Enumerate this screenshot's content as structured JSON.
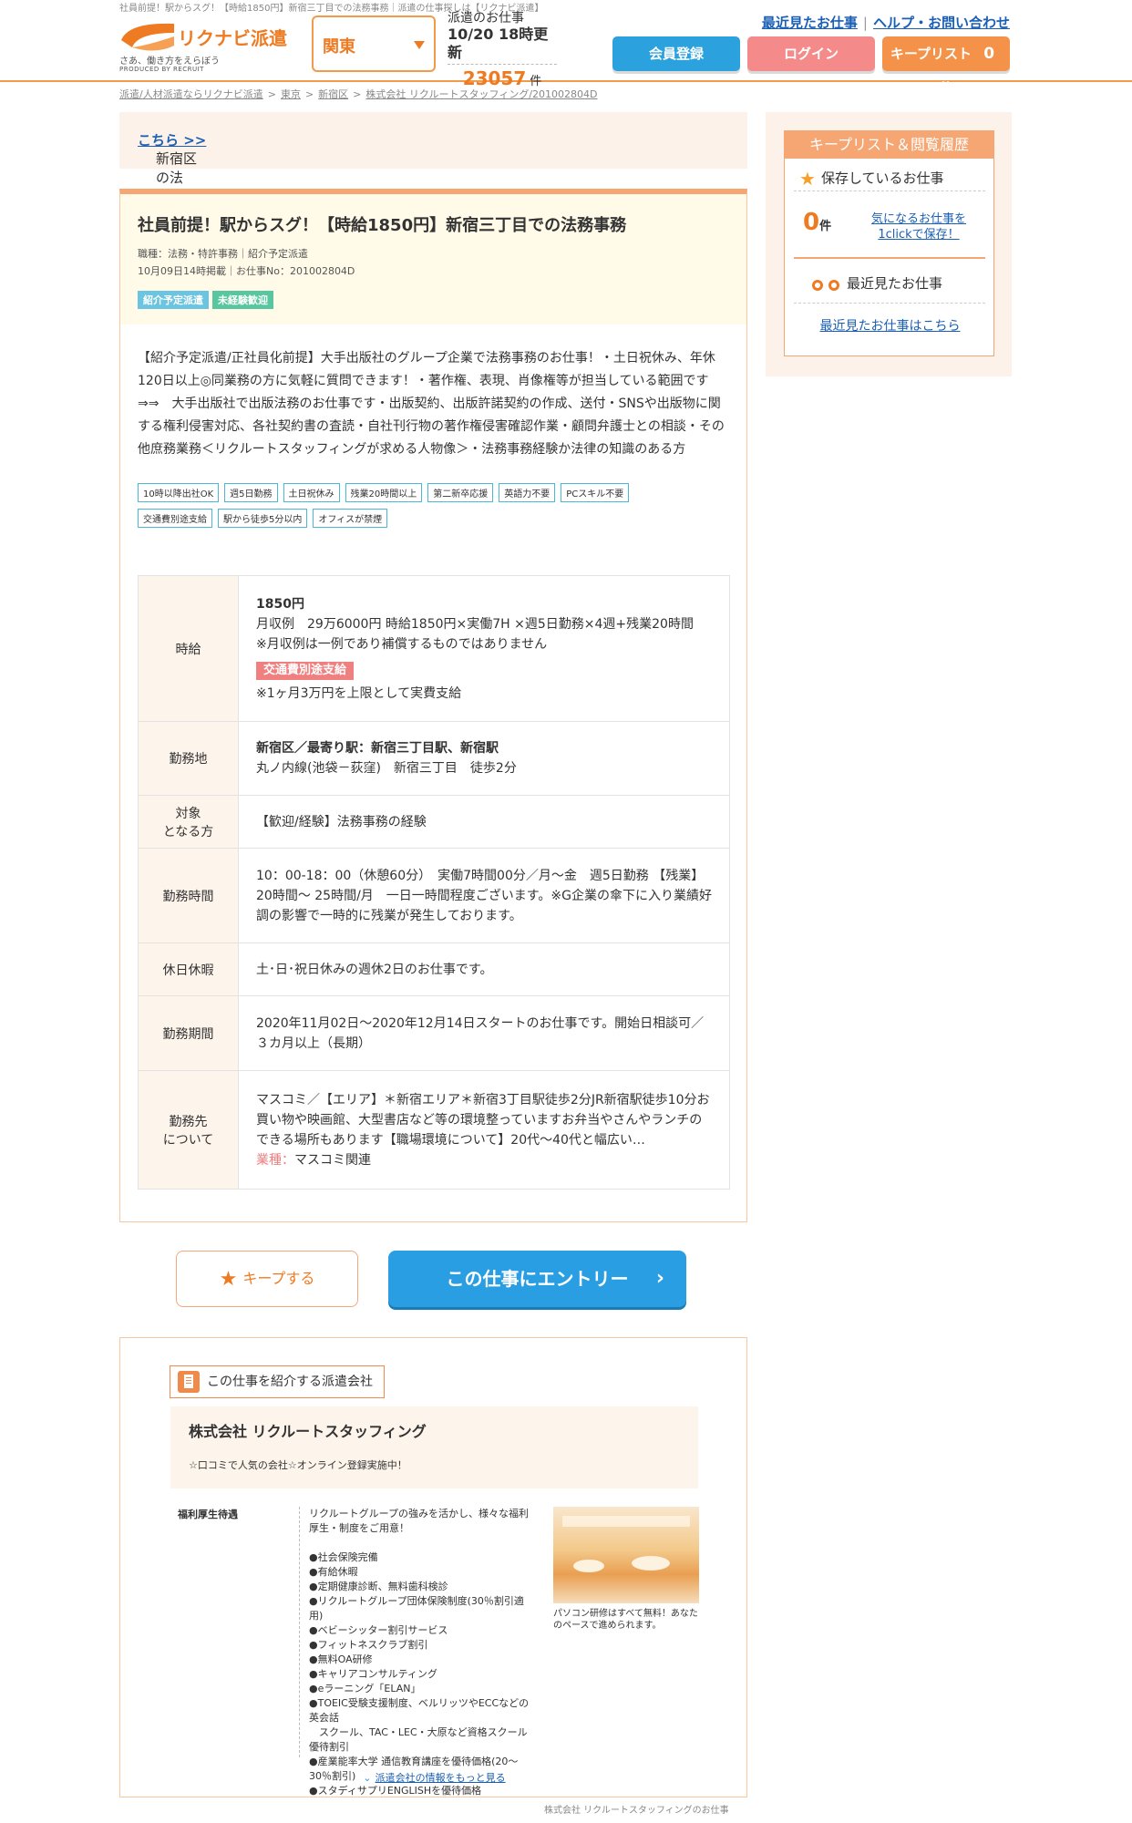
{
  "page": {
    "top_line": "社員前提！駅からスグ！【時給1850円】新宿三丁目での法務事務｜派遣の仕事探しは【リクナビ派遣】"
  },
  "header": {
    "logo_text": "リクナビ派遣",
    "logo_tagline": "さあ、働き方をえらぼう",
    "logo_produced": "PRODUCED BY RECRUIT",
    "region": "関東",
    "count_label": "派遣のお仕事",
    "count_updated": "10/20 18時更新",
    "count_number": "23057",
    "count_unit": "件",
    "links": [
      "最近見たお仕事",
      "ヘルプ・お問い合わせ"
    ],
    "register_label": "会員登録",
    "login_label": "ログイン",
    "keeplist_label": "キープリスト",
    "keeplist_count": "0",
    "keeplist_unit": "件"
  },
  "breadcrumb": [
    "派遣/人材派遣ならリクナビ派遣",
    "東京",
    "新宿区",
    "株式会社 リクルートスタッフィング/201002804D"
  ],
  "notice": {
    "text": "新宿区の法務・特許事務のお仕事一覧は",
    "link": "こちら >>"
  },
  "job": {
    "title": "社員前提！駅からスグ！【時給1850円】新宿三丁目での法務事務",
    "category": "職種：法務・特許事務｜紹介予定派遣",
    "posted": "10月09日14時掲載｜お仕事No：201002804D",
    "badges": [
      "紹介予定派遣",
      "未経験歓迎"
    ],
    "description": "【紹介予定派遣/正社員化前提】大手出版社のグループ企業で法務事務のお仕事！・土日祝休み、年休120日以上◎同業務の方に気軽に質問できます！・著作権、表現、肖像権等が担当している範囲です　⇒⇒　大手出版社で出版法務のお仕事です・出版契約、出版許諾契約の作成、送付・SNSや出版物に関する権利侵害対応、各社契約書の査読・自社刊行物の著作権侵害確認作業・顧問弁護士との相談・その他庶務業務＜リクルートスタッフィングが求める人物像＞・法務事務経験か法律の知識のある方",
    "tags": [
      "10時以降出社OK",
      "週5日勤務",
      "土日祝休み",
      "残業20時間以上",
      "第二新卒応援",
      "英語力不要",
      "PCスキル不要",
      "交通費別途支給",
      "駅から徒歩5分以内",
      "オフィスが禁煙"
    ],
    "spec": {
      "wage_label": "時給",
      "wage_value": "1850円",
      "wage_detail": "月収例　29万6000円 時給1850円×実働7H ×週5日勤務×4週+残業20時間　※月収例は一例であり補償するものではありません",
      "wage_pill": "交通費別途支給",
      "wage_note": "※1ヶ月3万円を上限として実費支給",
      "location_label": "勤務地",
      "location_main": "新宿区／最寄り駅：新宿三丁目駅、新宿駅",
      "location_sub": "丸ノ内線(池袋－荻窪)　新宿三丁目　徒歩2分",
      "target_label_1": "対象",
      "target_label_2": "となる方",
      "target_value": "【歓迎/経験】法務事務の経験",
      "hours_label": "勤務時間",
      "hours_value": "10：00-18：00（休憩60分）　実働7時間00分／月～金　週5日勤務 【残業】20時間～ 25時間/月　一日一時間程度ございます。※G企業の傘下に入り業績好調の影響で一時的に残業が発生しております。",
      "holiday_label": "休日休暇",
      "holiday_value": "土･日･祝日休みの週休2日のお仕事です。",
      "period_label": "勤務期間",
      "period_value": "2020年11月02日～2020年12月14日スタートのお仕事です。開始日相談可／３カ月以上（長期）",
      "company_label_1": "勤務先",
      "company_label_2": "について",
      "company_value": "マスコミ／【エリア】＊新宿エリア＊新宿3丁目駅徒歩2分JR新宿駅徒歩10分お買い物や映画館、大型書店など等の環境整っていますお弁当やさんやランチのできる場所もあります【職場環境について】20代～40代と幅広い…",
      "industry_label": "業種：",
      "industry_value": "マスコミ関連"
    }
  },
  "actions": {
    "keep_label": "キープする",
    "entry_label": "この仕事にエントリー"
  },
  "agency": {
    "section_label": "この仕事を紹介する派遣会社",
    "name": "株式会社 リクルートスタッフィング",
    "catch": "☆口コミで人気の会社☆オンライン登録実施中！",
    "welfare_label": "福利厚生待遇",
    "welfare_text": "リクルートグループの強みを活かし、様々な福利厚生・制度をご用意！\n\n●社会保険完備\n●有給休暇\n●定期健康診断、無料歯科検診\n●リクルートグループ団体保険制度(30％割引適用)\n●ベビーシッター割引サービス\n●フィットネスクラブ割引\n●無料OA研修\n●キャリアコンサルティング\n●eラーニング「ELAN」\n●TOEIC受験支援制度、ベルリッツやECCなどの英会話\n　スクール、TAC・LEC・大原など資格スクール優待割引\n●産業能率大学 通信教育講座を優待価格(20～30％割引)\n●スタディサプリENGLISHを優待価格",
    "photo_caption": "パソコン研修はすべて無料！あなたのペースで進められます。",
    "more_link": "派遣会社の情報をもっと見る",
    "foot_note": "株式会社 リクルートスタッフィングのお仕事"
  },
  "sidebar": {
    "title": "キープリスト＆閲覧履歴",
    "saved_label": "保存しているお仕事",
    "saved_count": "0",
    "saved_unit": "件",
    "save_link": "気になるお仕事を1clickで保存！",
    "recent_label": "最近見たお仕事",
    "recent_link": "最近見たお仕事はこちら"
  }
}
